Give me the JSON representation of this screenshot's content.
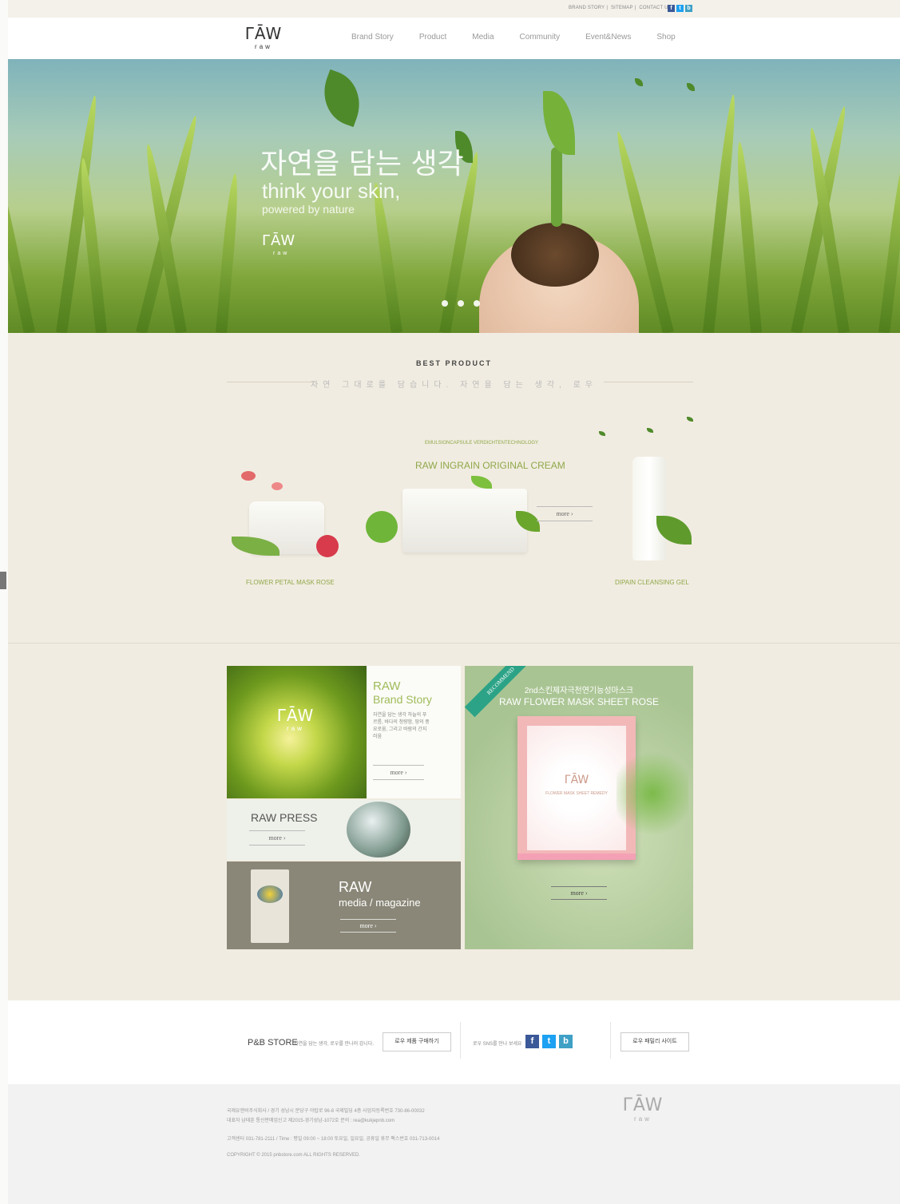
{
  "util": {
    "links": [
      "BRAND STORY",
      "SITEMAP",
      "CONTACT US"
    ],
    "sns": [
      "f",
      "t",
      "b"
    ]
  },
  "header": {
    "logo": "ΓĀW",
    "logo_sub": "raw",
    "nav": [
      "Brand Story",
      "Product",
      "Media",
      "Community",
      "Event&News",
      "Shop"
    ]
  },
  "hero": {
    "title_ko": "자연을 담는 생각",
    "title_en": "think your skin,",
    "sub": "powered by nature",
    "logo": "ΓĀW",
    "logo_sub": "raw",
    "slides": 3
  },
  "best": {
    "title": "BEST PRODUCT",
    "subtitle": "자연 그대로를 담습니다. 자연을 담는 생각, 로우",
    "center_kicker": "EMULSIONCAPSULE VERDICHTENTECHNOLOGY",
    "center_name": "RAW INGRAIN ORIGINAL CREAM",
    "center_more": "more ›",
    "left_name": "FLOWER PETAL MASK ROSE",
    "right_name": "DIPAIN CLEANSING GEL"
  },
  "features": {
    "brand_title1": "RAW",
    "brand_title2": "Brand Story",
    "brand_text": "자연을 담는 생각 하늘의 푸르름, 바다의 청량함, 땅의 풍요로움, 그리고 바람의 간지러움",
    "brand_more": "more ›",
    "press_title": "RAW PRESS",
    "press_more": "more ›",
    "media_title1": "RAW",
    "media_title2": "media / magazine",
    "media_more": "more ›",
    "mask_kicker": "2nd스킨제자극천연기능성마스크",
    "mask_title": "RAW FLOWER MASK SHEET ROSE",
    "ribbon": "RECOMMEND",
    "mask_more": "more ›",
    "sheet_brand": "ΓĀW",
    "sheet_text": "FLOWER MASK SHEET REMEDY"
  },
  "store": {
    "title": "P&B STORE",
    "desc": "자연을 담는 생각, 로우를 만나러 갑니다.",
    "buy_btn": "로우 제품 구매하기",
    "sns_desc": "로우 SNS를 만나 보세요",
    "family_btn": "로우 패밀리 사이트"
  },
  "footer": {
    "line1": "국제유앤비주식회사 / 경기 성남시 분당구 야탑로 96-8 국제빌딩 4층 사업자등록번호 730-86-00032",
    "line2": "대표자 남태훈 통신판매업신고 제2015-경기성남-1072호 문의 : rea@kukjepnb.com",
    "line3": "고객센터 031-781-2111 / Time : 평일 09:00 ~ 18:00 토요일, 일요일, 공휴일 휴무 팩스번호 031-713-0014",
    "line4": "COPYRIGHT © 2015 pnbstore.com ALL RIGHTS RESERVED.",
    "logo": "ΓĀW",
    "logo_sub": "raw"
  },
  "colors": {
    "page_bg": "#f1ece1",
    "accent_green": "#8fa84a",
    "ribbon": "#2ca386",
    "facebook": "#3b5998",
    "twitter": "#1da1f2",
    "blog": "#3fa0c6"
  }
}
